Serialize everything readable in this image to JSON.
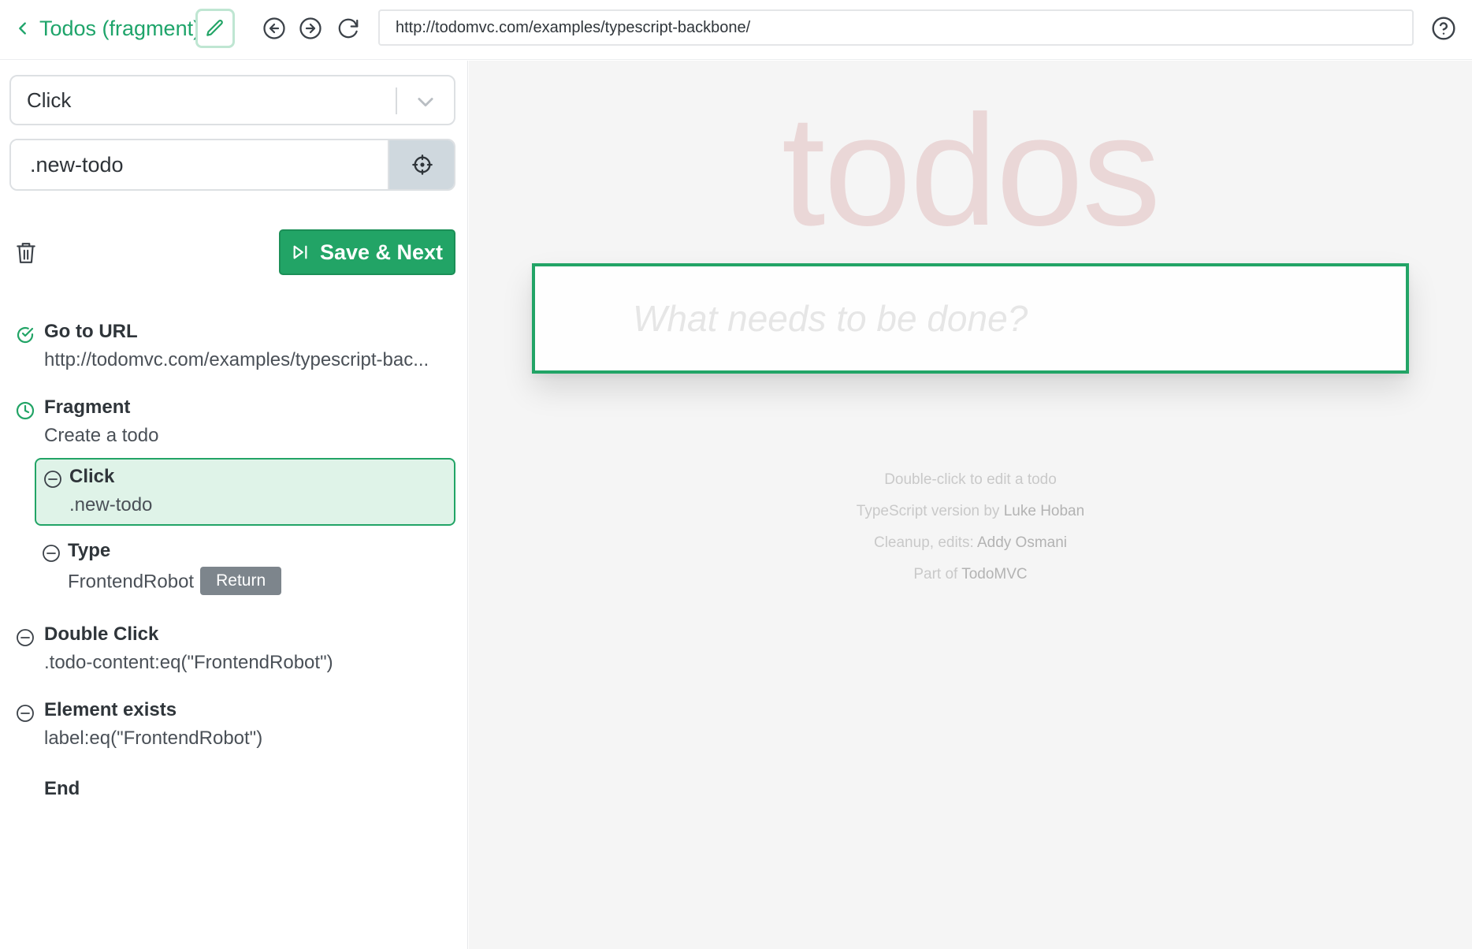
{
  "topbar": {
    "back_label": "Todos (fragment)",
    "url": "http://todomvc.com/examples/typescript-backbone/",
    "icons": [
      "chevron-left-icon",
      "pencil-icon",
      "arrow-left-circle-icon",
      "arrow-right-circle-icon",
      "refresh-icon",
      "help-circle-icon"
    ]
  },
  "editor": {
    "action_select": "Click",
    "selector_value": ".new-todo",
    "save_label": "Save & Next"
  },
  "steps": [
    {
      "title": "Go to URL",
      "detail": "http://todomvc.com/examples/typescript-bac...",
      "status": "done"
    },
    {
      "title": "Fragment",
      "detail": "Create a todo",
      "status": "pending"
    },
    {
      "title": "Double Click",
      "detail": ".todo-content:eq(\"FrontendRobot\")",
      "status": "idle"
    },
    {
      "title": "Element exists",
      "detail": "label:eq(\"FrontendRobot\")",
      "status": "idle"
    },
    {
      "title": "End"
    }
  ],
  "substeps": [
    {
      "title": "Click",
      "detail": ".new-todo",
      "active": true
    },
    {
      "title": "Type",
      "detail": "FrontendRobot",
      "key": "Return"
    }
  ],
  "preview": {
    "heading": "todos",
    "input_placeholder": "What needs to be done?",
    "info": {
      "line1": "Double-click to edit a todo",
      "line2_prefix": "TypeScript version by ",
      "line2_link": "Luke Hoban",
      "line3_prefix": "Cleanup, edits: ",
      "line3_link": "Addy Osmani",
      "line4_prefix": "Part of ",
      "line4_link": "TodoMVC"
    }
  },
  "colors": {
    "accent": "#22a466",
    "accent_light": "#dff3e8",
    "heading": "#af2f2f",
    "preview_bg": "#f5f5f5"
  }
}
